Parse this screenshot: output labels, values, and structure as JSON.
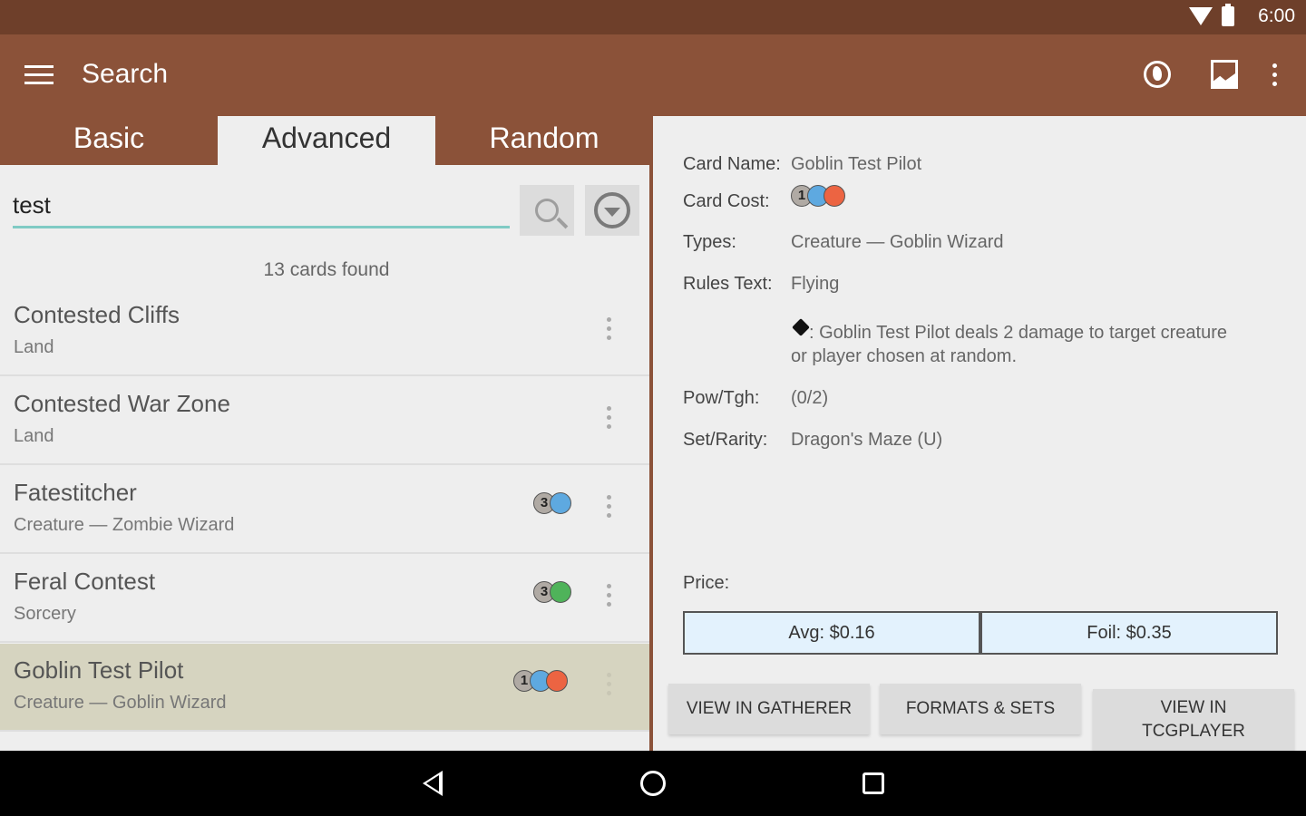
{
  "status_bar": {
    "time": "6:00",
    "icons": [
      "wifi-icon",
      "battery-icon"
    ]
  },
  "app_bar": {
    "title": "Search",
    "icons": [
      "menu-icon",
      "globe-icon",
      "chart-icon",
      "overflow-menu-icon"
    ]
  },
  "tabs": [
    {
      "label": "Basic",
      "active": false
    },
    {
      "label": "Advanced",
      "active": true
    },
    {
      "label": "Random",
      "active": false
    }
  ],
  "search": {
    "value": "test",
    "placeholder": ""
  },
  "results": {
    "count_text": "13 cards found",
    "cards": [
      {
        "name": "Contested Cliffs",
        "type": "Land",
        "mana": []
      },
      {
        "name": "Contested War Zone",
        "type": "Land",
        "mana": []
      },
      {
        "name": "Fatestitcher",
        "type": "Creature  — Zombie Wizard",
        "mana": [
          "3",
          "U"
        ]
      },
      {
        "name": "Feral Contest",
        "type": "Sorcery",
        "mana": [
          "3",
          "G"
        ]
      },
      {
        "name": "Goblin Test Pilot",
        "type": "Creature  — Goblin Wizard",
        "mana": [
          "1",
          "U",
          "R"
        ],
        "selected": true
      }
    ]
  },
  "details": {
    "card_name_label": "Card Name:",
    "card_name": "Goblin Test Pilot",
    "card_cost_label": "Card Cost:",
    "card_cost": [
      "1",
      "U",
      "R"
    ],
    "types_label": "Types:",
    "types": "Creature  — Goblin Wizard",
    "rules_label": "Rules Text:",
    "rules_line1": "Flying",
    "rules_line2": ": Goblin Test Pilot deals 2 damage to target creature",
    "rules_line3": "or player chosen at random.",
    "pow_label": "Pow/Tgh:",
    "pow": "(0/2)",
    "set_label": "Set/Rarity:",
    "set": "Dragon's Maze (U)",
    "price_label": "Price:",
    "price_avg": "Avg: $0.16",
    "price_foil": "Foil: $0.35",
    "btn_gatherer": "VIEW IN GATHERER",
    "btn_formats": "FORMATS & SETS",
    "btn_tcg_line1": "VIEW IN",
    "btn_tcg_line2": "TCGPLAYER"
  },
  "colors": {
    "status_bar": "#6e3f2a",
    "app_bar": "#8b5239",
    "accent": "#80cbc4",
    "selected_row": "#d6d4c0",
    "mana_blue": "#5ea9e0",
    "mana_red": "#ec6442",
    "mana_green": "#4fb35a"
  }
}
